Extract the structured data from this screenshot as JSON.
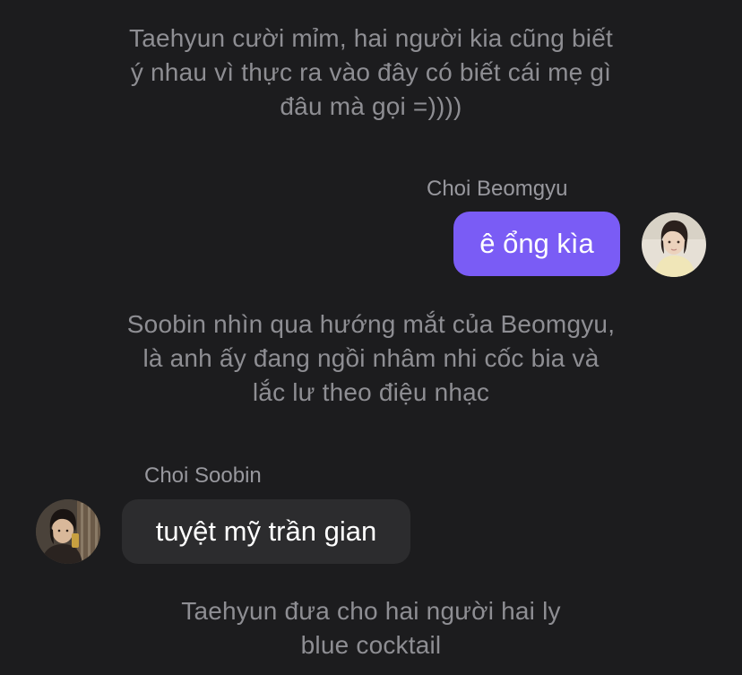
{
  "chat": {
    "narration_1": {
      "lines": [
        "Taehyun cười mỉm, hai người kia cũng biết",
        "ý nhau vì thực ra vào đây có biết cái mẹ gì",
        "đâu mà gọi =))))"
      ]
    },
    "message_1": {
      "sender": "Choi Beomgyu",
      "text": "ê ổng kìa",
      "avatar_icon": "person-avatar-light",
      "bubble_color": "#7a5cf5"
    },
    "narration_2": {
      "lines": [
        "Soobin nhìn qua hướng mắt của Beomgyu,",
        "là anh ấy đang ngồi nhâm nhi cốc bia và",
        "lắc lư theo điệu nhạc"
      ]
    },
    "message_2": {
      "sender": "Choi Soobin",
      "text": "tuyệt mỹ trần gian",
      "avatar_icon": "person-avatar-dark",
      "bubble_color": "#2c2c2e"
    },
    "narration_3": {
      "lines": [
        "Taehyun đưa cho hai người hai ly",
        "blue cocktail"
      ]
    }
  },
  "colors": {
    "background": "#1c1c1e",
    "narration_text": "#8e8e93",
    "sender_name": "#98989e"
  }
}
